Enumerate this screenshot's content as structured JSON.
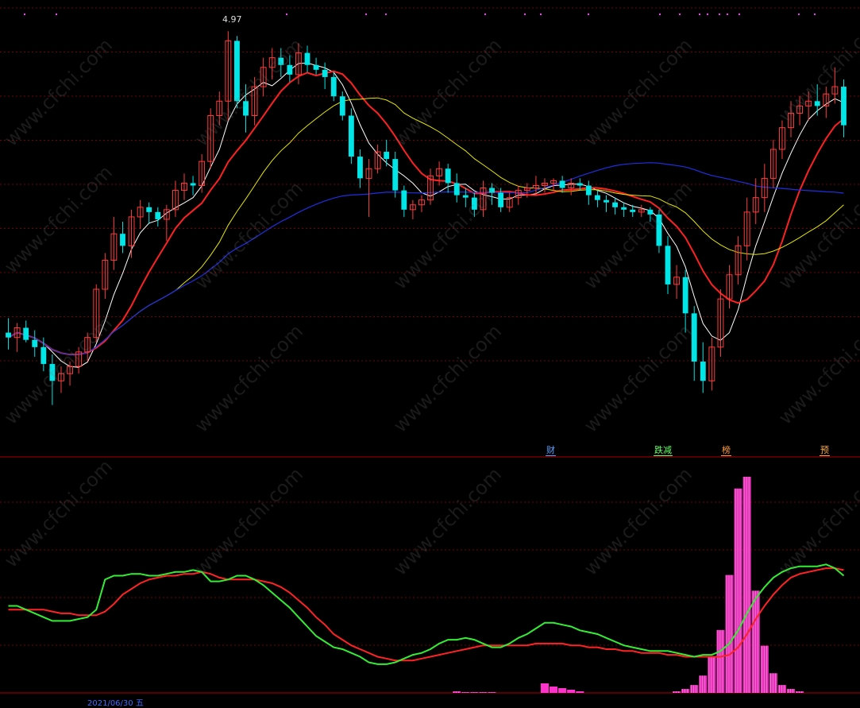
{
  "watermark": "www.cfchi.com",
  "price_high_label": "4.97",
  "date_fragment": "2021/06/30 五",
  "event_tags": {
    "fin": "财",
    "down": "跌减",
    "rank": "榜",
    "fore": "预"
  },
  "colors": {
    "up": "#ff3b3b",
    "down": "#00e5e5",
    "ma5": "#ffffff",
    "ma10": "#ff2020",
    "ma20": "#e6e600",
    "ma60": "#1f2fe0",
    "k": "#33ee33",
    "d": "#ff2222",
    "vol": "#ff33cc",
    "grid": "#7a0000"
  },
  "chart_data": {
    "type": "candlestick",
    "candles": [
      [
        3.72,
        3.78,
        3.65,
        3.7
      ],
      [
        3.7,
        3.76,
        3.64,
        3.74
      ],
      [
        3.74,
        3.77,
        3.68,
        3.69
      ],
      [
        3.69,
        3.73,
        3.62,
        3.66
      ],
      [
        3.66,
        3.7,
        3.56,
        3.59
      ],
      [
        3.59,
        3.63,
        3.42,
        3.52
      ],
      [
        3.52,
        3.58,
        3.47,
        3.55
      ],
      [
        3.55,
        3.6,
        3.5,
        3.58
      ],
      [
        3.58,
        3.66,
        3.55,
        3.64
      ],
      [
        3.64,
        3.72,
        3.6,
        3.7
      ],
      [
        3.7,
        3.92,
        3.68,
        3.9
      ],
      [
        3.9,
        4.05,
        3.86,
        4.02
      ],
      [
        4.02,
        4.2,
        3.98,
        4.13
      ],
      [
        4.13,
        4.18,
        4.05,
        4.08
      ],
      [
        4.08,
        4.23,
        4.03,
        4.2
      ],
      [
        4.2,
        4.27,
        4.15,
        4.24
      ],
      [
        4.24,
        4.26,
        4.17,
        4.22
      ],
      [
        4.22,
        4.24,
        4.16,
        4.19
      ],
      [
        4.19,
        4.25,
        4.1,
        4.23
      ],
      [
        4.23,
        4.35,
        4.2,
        4.31
      ],
      [
        4.31,
        4.38,
        4.27,
        4.34
      ],
      [
        4.34,
        4.37,
        4.29,
        4.33
      ],
      [
        4.33,
        4.46,
        4.3,
        4.43
      ],
      [
        4.43,
        4.65,
        4.4,
        4.62
      ],
      [
        4.62,
        4.72,
        4.58,
        4.68
      ],
      [
        4.68,
        4.97,
        4.6,
        4.93
      ],
      [
        4.93,
        4.95,
        4.65,
        4.68
      ],
      [
        4.68,
        4.75,
        4.55,
        4.62
      ],
      [
        4.62,
        4.78,
        4.58,
        4.74
      ],
      [
        4.74,
        4.86,
        4.7,
        4.82
      ],
      [
        4.82,
        4.9,
        4.77,
        4.86
      ],
      [
        4.86,
        4.9,
        4.78,
        4.83
      ],
      [
        4.83,
        4.87,
        4.76,
        4.79
      ],
      [
        4.79,
        4.92,
        4.75,
        4.88
      ],
      [
        4.88,
        4.91,
        4.8,
        4.83
      ],
      [
        4.83,
        4.86,
        4.79,
        4.81
      ],
      [
        4.81,
        4.84,
        4.73,
        4.78
      ],
      [
        4.78,
        4.8,
        4.68,
        4.7
      ],
      [
        4.7,
        4.72,
        4.6,
        4.62
      ],
      [
        4.62,
        4.65,
        4.42,
        4.45
      ],
      [
        4.45,
        4.48,
        4.32,
        4.36
      ],
      [
        4.36,
        4.44,
        4.2,
        4.4
      ],
      [
        4.4,
        4.5,
        4.38,
        4.47
      ],
      [
        4.47,
        4.52,
        4.41,
        4.44
      ],
      [
        4.44,
        4.47,
        4.28,
        4.31
      ],
      [
        4.31,
        4.33,
        4.2,
        4.23
      ],
      [
        4.23,
        4.27,
        4.19,
        4.25
      ],
      [
        4.25,
        4.29,
        4.22,
        4.27
      ],
      [
        4.27,
        4.4,
        4.25,
        4.37
      ],
      [
        4.37,
        4.43,
        4.33,
        4.4
      ],
      [
        4.4,
        4.42,
        4.3,
        4.34
      ],
      [
        4.34,
        4.38,
        4.26,
        4.29
      ],
      [
        4.29,
        4.32,
        4.24,
        4.28
      ],
      [
        4.28,
        4.3,
        4.2,
        4.23
      ],
      [
        4.23,
        4.35,
        4.2,
        4.32
      ],
      [
        4.32,
        4.34,
        4.25,
        4.3
      ],
      [
        4.3,
        4.32,
        4.22,
        4.24
      ],
      [
        4.24,
        4.3,
        4.22,
        4.28
      ],
      [
        4.28,
        4.33,
        4.25,
        4.31
      ],
      [
        4.31,
        4.34,
        4.28,
        4.32
      ],
      [
        4.32,
        4.37,
        4.29,
        4.33
      ],
      [
        4.33,
        4.36,
        4.3,
        4.34
      ],
      [
        4.34,
        4.36,
        4.31,
        4.35
      ],
      [
        4.35,
        4.37,
        4.3,
        4.32
      ],
      [
        4.32,
        4.36,
        4.29,
        4.34
      ],
      [
        4.34,
        4.36,
        4.31,
        4.33
      ],
      [
        4.33,
        4.35,
        4.25,
        4.29
      ],
      [
        4.29,
        4.31,
        4.24,
        4.27
      ],
      [
        4.27,
        4.29,
        4.22,
        4.26
      ],
      [
        4.26,
        4.28,
        4.21,
        4.24
      ],
      [
        4.24,
        4.26,
        4.2,
        4.23
      ],
      [
        4.23,
        4.25,
        4.2,
        4.22
      ],
      [
        4.22,
        4.25,
        4.2,
        4.23
      ],
      [
        4.23,
        4.24,
        4.18,
        4.21
      ],
      [
        4.21,
        4.23,
        4.05,
        4.08
      ],
      [
        4.08,
        4.12,
        3.88,
        3.92
      ],
      [
        3.92,
        4.0,
        3.86,
        3.95
      ],
      [
        3.95,
        3.98,
        3.72,
        3.8
      ],
      [
        3.8,
        3.83,
        3.52,
        3.6
      ],
      [
        3.6,
        3.68,
        3.47,
        3.52
      ],
      [
        3.52,
        3.7,
        3.48,
        3.66
      ],
      [
        3.66,
        3.9,
        3.62,
        3.86
      ],
      [
        3.86,
        4.0,
        3.82,
        3.96
      ],
      [
        3.96,
        4.12,
        3.92,
        4.08
      ],
      [
        4.08,
        4.28,
        4.02,
        4.22
      ],
      [
        4.22,
        4.36,
        4.17,
        4.28
      ],
      [
        4.28,
        4.42,
        4.22,
        4.36
      ],
      [
        4.36,
        4.52,
        4.32,
        4.48
      ],
      [
        4.48,
        4.6,
        4.44,
        4.57
      ],
      [
        4.57,
        4.68,
        4.53,
        4.63
      ],
      [
        4.63,
        4.7,
        4.58,
        4.66
      ],
      [
        4.66,
        4.72,
        4.6,
        4.68
      ],
      [
        4.68,
        4.75,
        4.62,
        4.66
      ],
      [
        4.66,
        4.74,
        4.61,
        4.71
      ],
      [
        4.71,
        4.82,
        4.67,
        4.74
      ],
      [
        4.74,
        4.77,
        4.53,
        4.58
      ]
    ],
    "ma_windows": [
      5,
      10,
      20,
      60
    ],
    "y_range": [
      3.32,
      5.05
    ],
    "events": [
      {
        "index": 66,
        "key": "fin"
      },
      {
        "index": 77,
        "key": "down"
      },
      {
        "index": 84,
        "key": "rank"
      },
      {
        "index": 94,
        "key": "fore"
      }
    ],
    "indicator": {
      "k": [
        42,
        42,
        40,
        38,
        36,
        34,
        34,
        34,
        35,
        36,
        40,
        56,
        58,
        58,
        59,
        59,
        58,
        58,
        59,
        60,
        60,
        61,
        60,
        55,
        55,
        56,
        58,
        58,
        56,
        53,
        49,
        45,
        41,
        36,
        31,
        26,
        23,
        20,
        19,
        17,
        15,
        12,
        11,
        11,
        12,
        14,
        16,
        17,
        19,
        22,
        24,
        24,
        25,
        24,
        22,
        20,
        20,
        22,
        25,
        27,
        30,
        33,
        33,
        32,
        31,
        29,
        28,
        27,
        25,
        23,
        21,
        20,
        19,
        18,
        18,
        18,
        17,
        16,
        15,
        16,
        16,
        18,
        22,
        29,
        38,
        46,
        52,
        57,
        60,
        62,
        63,
        63,
        63,
        64,
        62,
        58
      ],
      "d": [
        40,
        40,
        40,
        40,
        40,
        39,
        38,
        38,
        37,
        37,
        37,
        39,
        43,
        48,
        51,
        54,
        56,
        57,
        58,
        58,
        59,
        59,
        60,
        59,
        57,
        56,
        56,
        56,
        56,
        55,
        54,
        52,
        49,
        45,
        41,
        36,
        32,
        27,
        24,
        21,
        19,
        17,
        15,
        14,
        13,
        13,
        13,
        14,
        15,
        16,
        17,
        18,
        19,
        20,
        21,
        21,
        21,
        21,
        21,
        21,
        22,
        22,
        22,
        22,
        21,
        21,
        20,
        20,
        19,
        19,
        18,
        18,
        17,
        17,
        17,
        16,
        16,
        15,
        15,
        15,
        15,
        15,
        16,
        20,
        27,
        35,
        42,
        48,
        53,
        57,
        59,
        60,
        61,
        62,
        62,
        61
      ],
      "y_range": [
        0,
        100
      ]
    },
    "volume_spikes": [
      0,
      0,
      0,
      0,
      0,
      0,
      0,
      0,
      0,
      0,
      0,
      0,
      0,
      0,
      0,
      0,
      0,
      0,
      0,
      0,
      0,
      0,
      0,
      0,
      0,
      0,
      0,
      0,
      0,
      0,
      0,
      0,
      0,
      0,
      0,
      0,
      0,
      0,
      0,
      0,
      0,
      0,
      0,
      0,
      0,
      0,
      0,
      0,
      0,
      0,
      0,
      0,
      0,
      0,
      0,
      0,
      0,
      0,
      0,
      0,
      0,
      6,
      4,
      3,
      2,
      1,
      0,
      0,
      0,
      0,
      0,
      0,
      0,
      0,
      0,
      0,
      0,
      0,
      0,
      0,
      0,
      0,
      0,
      0,
      0,
      0,
      0,
      0,
      0,
      0,
      0,
      0,
      0,
      0,
      0,
      0
    ],
    "volume_bars": [
      0,
      0,
      0,
      0,
      0,
      0,
      0,
      0,
      0,
      0,
      0,
      0,
      0,
      0,
      0,
      0,
      0,
      0,
      0,
      0,
      0,
      0,
      0,
      0,
      0,
      0,
      0,
      0,
      0,
      0,
      0,
      0,
      0,
      0,
      0,
      0,
      0,
      0,
      0,
      0,
      0,
      0,
      0,
      0,
      0,
      0,
      0,
      0,
      0,
      0,
      0,
      2,
      1,
      1,
      1,
      1,
      0,
      0,
      0,
      0,
      0,
      0,
      0,
      0,
      0,
      0,
      0,
      0,
      0,
      0,
      0,
      0,
      0,
      0,
      0,
      0,
      0,
      0,
      0,
      0,
      7,
      4,
      2,
      1,
      1,
      0,
      0,
      0,
      0,
      0,
      0,
      0,
      0,
      0,
      0,
      0
    ]
  }
}
